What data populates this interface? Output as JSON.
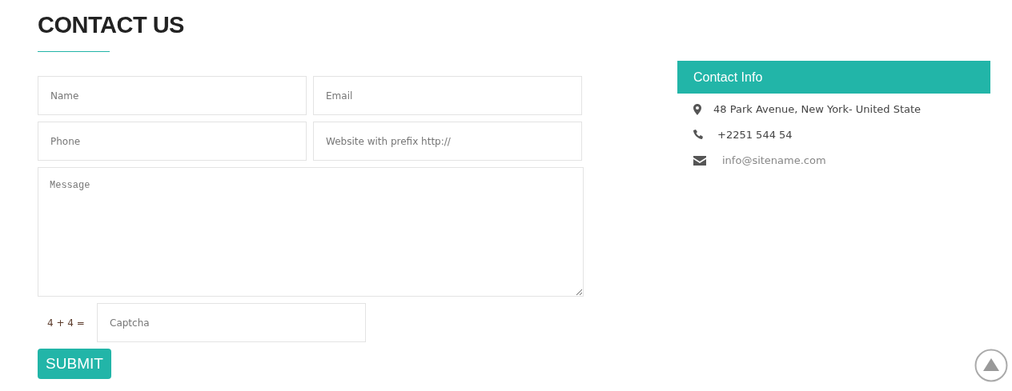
{
  "heading": "CONTACT US",
  "form": {
    "fields": [
      {
        "placeholder": "Name"
      },
      {
        "placeholder": "Email"
      },
      {
        "placeholder": "Phone"
      },
      {
        "placeholder": "Website with prefix http://"
      }
    ],
    "message": {
      "placeholder": "Message"
    },
    "captcha": {
      "question": "4 + 4 =",
      "placeholder": "Captcha"
    },
    "submit": "SUBMIT"
  },
  "contact_info": {
    "title": "Contact Info",
    "items": [
      {
        "kind": "address",
        "text": "48 Park Avenue, New York- United State"
      },
      {
        "kind": "phone",
        "text": "+2251 544 54"
      },
      {
        "kind": "email",
        "text": "info@sitename.com"
      }
    ]
  }
}
